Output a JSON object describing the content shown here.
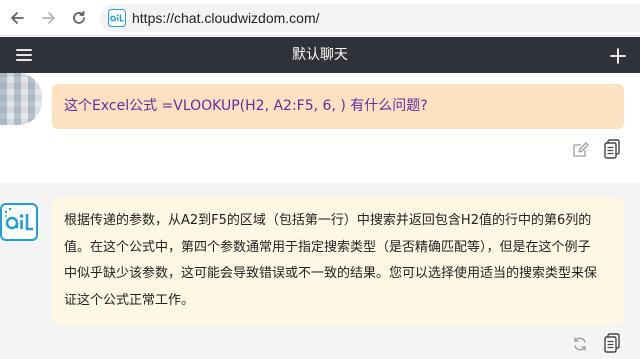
{
  "browser": {
    "url": "https://chat.cloudwizdom.com/",
    "site_icon": "aiL-logo-icon"
  },
  "app": {
    "title": "默认聊天",
    "menu_icon": "hamburger-menu-icon",
    "add_icon": "plus-icon"
  },
  "messages": {
    "user": {
      "text": "这个Excel公式 =VLOOKUP(H2, A2:F5, 6, ) 有什么问题?",
      "actions": [
        "edit-icon",
        "copy-icon"
      ]
    },
    "assistant": {
      "avatar_label": "aiL",
      "lines": [
        "根据传递的参数，从A2到F5的区域（包括第一行）中搜索并返回包含H2值的行中的第6列的",
        "值。在这个公式中，第四个参数通常用于指定搜索类型（是否精确匹配等），但是在这个例子",
        "中似乎缺少该参数，这可能会导致错误或不一致的结果。您可以选择使用适当的搜索类型来保",
        "证这个公式正常工作。"
      ],
      "actions": [
        "regenerate-icon",
        "copy-icon"
      ]
    }
  },
  "colors": {
    "header_bg": "#2f3238",
    "user_bubble_bg": "#fde2c2",
    "user_text": "#6b2a9c",
    "bot_bubble_bg": "#fdf7e3",
    "bot_logo": "#1f9fd6"
  }
}
